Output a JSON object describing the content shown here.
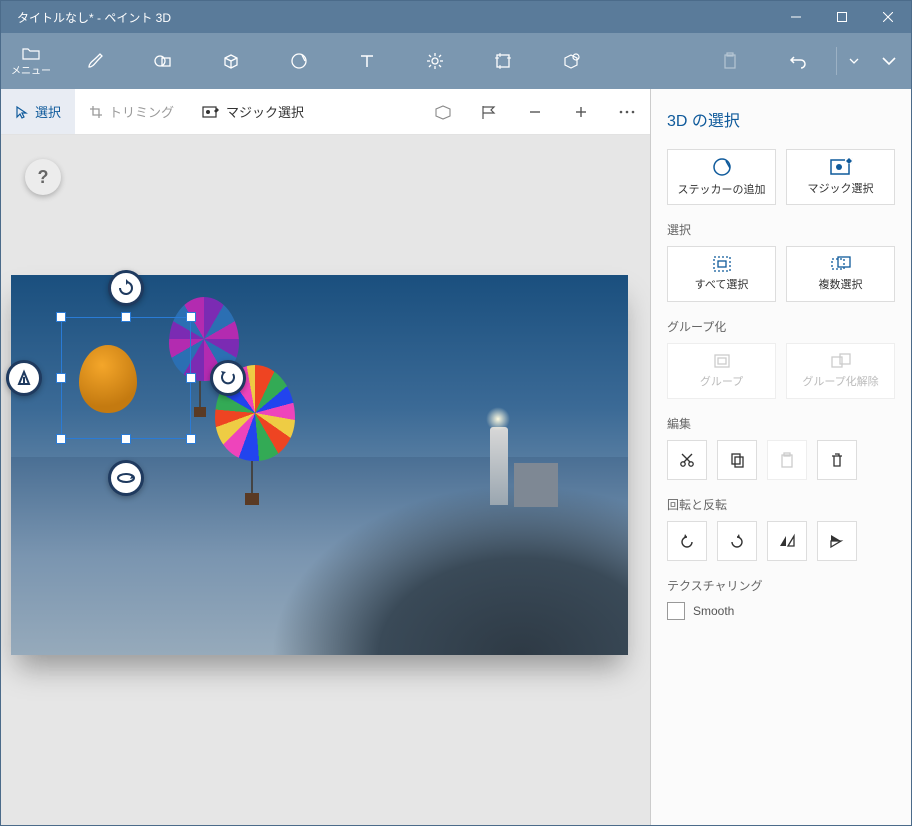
{
  "window": {
    "title": "タイトルなし* - ペイント 3D"
  },
  "menu": {
    "label": "メニュー"
  },
  "subtoolbar": {
    "select": "選択",
    "crop": "トリミング",
    "magic": "マジック選択"
  },
  "panel": {
    "title": "3D の選択",
    "add_sticker": "ステッカーの追加",
    "magic_select": "マジック選択",
    "section_select": "選択",
    "select_all": "すべて選択",
    "multi_select": "複数選択",
    "section_group": "グループ化",
    "group": "グループ",
    "ungroup": "グループ化解除",
    "section_edit": "編集",
    "section_rotate": "回転と反転",
    "section_texture": "テクスチャリング",
    "smooth": "Smooth"
  },
  "help": "?"
}
